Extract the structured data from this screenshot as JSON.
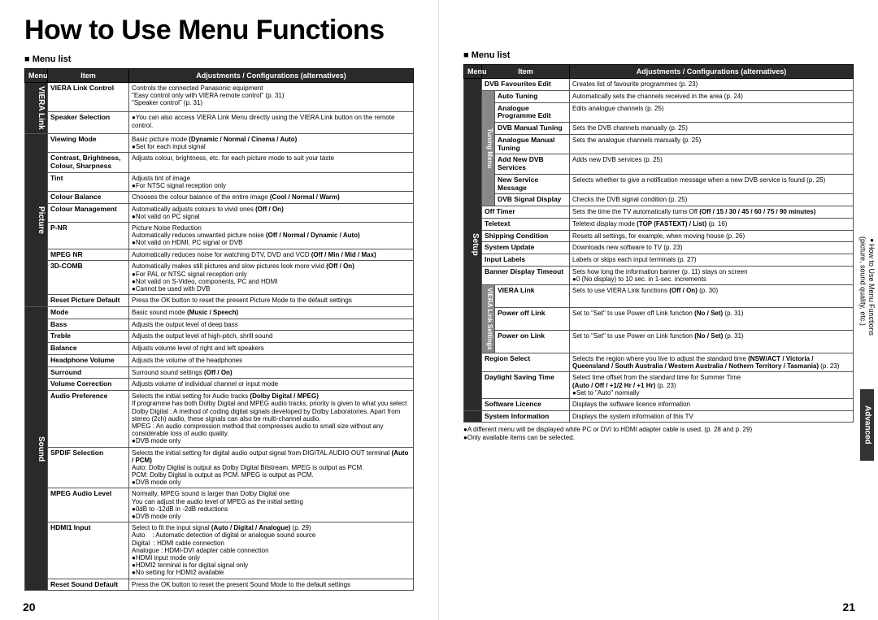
{
  "title": "How to Use Menu Functions",
  "menulist": "Menu list",
  "cols": {
    "menu": "Menu",
    "item": "Item",
    "adj": "Adjustments / Configurations (alternatives)"
  },
  "sec": {
    "viera": "VIERA Link",
    "picture": "Picture",
    "sound": "Sound",
    "setup": "Setup",
    "tuning": "Tuning Menu",
    "vls": "VIERA Link Settings"
  },
  "L": {
    "vieralinkcontrol": {
      "i": "VIERA Link Control",
      "a": "Controls the connected Panasonic equipment<br>\"Easy control only with VIERA remote control\" (p. 31)<br>\"Speaker control\" (p. 31)"
    },
    "speakersel": {
      "i": "Speaker Selection",
      "a": "<span class='dot'>●</span>You can also access VIERA Link Menu directly using the VIERA Link button on the remote control."
    },
    "viewmode": {
      "i": "Viewing Mode",
      "a": "Basic picture mode <b>(Dynamic / Normal / Cinema / Auto)</b><br><span class='dot'>●</span>Set for each input signal"
    },
    "cbsc": {
      "i": "Contrast, Brightness, Colour, Sharpness",
      "a": "Adjusts colour, brightness, etc. for each picture mode to suit your taste"
    },
    "tint": {
      "i": "Tint",
      "a": "Adjusts tint of image<br><span class='dot'>●</span>For NTSC signal reception only"
    },
    "colbal": {
      "i": "Colour Balance",
      "a": "Chooses the colour balance of the entire image <b>(Cool / Normal / Warm)</b>"
    },
    "colmgmt": {
      "i": "Colour Management",
      "a": "Automatically adjusts colours to vivid ones <b>(Off / On)</b><br><span class='dot'>●</span>Not valid on PC signal"
    },
    "pnr": {
      "i": "P-NR",
      "a": "Picture Noise Reduction<br>Automatically reduces unwanted picture noise <b>(Off / Normal / Dynamic / Auto)</b><br><span class='dot'>●</span>Not valid on HDMI, PC signal or DVB"
    },
    "mpegnr": {
      "i": "MPEG NR",
      "a": "Automatically reduces noise for watching DTV, DVD and VCD <b>(Off / Min / Mid / Max)</b>"
    },
    "3dcomb": {
      "i": "3D-COMB",
      "a": "Automatically makes still pictures and slow pictures look more vivid <b>(Off / On)</b><br><span class='dot'>●</span>For PAL or NTSC signal reception only<br><span class='dot'>●</span>Not valid on S-Video, components, PC and HDMI<br><span class='dot'>●</span>Cannot be used with DVB"
    },
    "resetpic": {
      "i": "Reset Picture Default",
      "a": "Press the OK button to reset the present Picture Mode to the default settings"
    },
    "mode": {
      "i": "Mode",
      "a": "Basic sound mode <b>(Music / Speech)</b>"
    },
    "bass": {
      "i": "Bass",
      "a": "Adjusts the output level of deep bass"
    },
    "treble": {
      "i": "Treble",
      "a": "Adjusts the output level of high-pitch, shrill sound"
    },
    "balance": {
      "i": "Balance",
      "a": "Adjusts volume level of right and left speakers"
    },
    "hpvol": {
      "i": "Headphone Volume",
      "a": "Adjusts the volume of the headphones"
    },
    "surround": {
      "i": "Surround",
      "a": "Surround sound settings <b>(Off / On)</b>"
    },
    "volcorr": {
      "i": "Volume Correction",
      "a": "Adjusts volume of individual channel or input mode"
    },
    "audiopref": {
      "i": "Audio Preference",
      "a": "Selects the initial setting for Audio tracks <b>(Dolby Digital / MPEG)</b><br>If programme has both Dolby Digital and MPEG audio tracks, priority is given to what you select<br>Dolby Digital : A method of coding digital signals developed by Dolby Laboratories. Apart from stereo (2ch) audio, these signals can also be multi-channel audio.<br>MPEG : An audio compression method that compresses audio to small size without any considerable loss of audio quality.<br><span class='dot'>●</span>DVB mode only"
    },
    "spdif": {
      "i": "SPDIF Selection",
      "a": "Selects the initial setting for digital audio output signal from DIGITAL AUDIO OUT terminal <b>(Auto / PCM)</b><br>Auto: Dolby Digital is output as Dolby Digital Bitstream. MPEG is output as PCM.<br>PCM: Dolby Digital is output as PCM. MPEG is output as PCM.<br><span class='dot'>●</span>DVB mode only"
    },
    "mpegaudio": {
      "i": "MPEG Audio Level",
      "a": "Normally, MPEG sound is larger than Dolby Digital one<br>You can adjust the audio level of MPEG as the initial setting<br><span class='dot'>●</span>0dB to -12dB in -2dB reductions<br><span class='dot'>●</span>DVB mode only"
    },
    "hdmi1": {
      "i": "HDMI1 Input",
      "a": "Select to fit the input signal <b>(Auto / Digital / Analogue)</b> (p. 29)<br>Auto&nbsp;&nbsp;&nbsp;&nbsp;: Automatic detection of digital or analogue sound source<br>Digital&nbsp;&nbsp;: HDMI cable connection<br>Analogue : HDMI-DVI adapter cable connection<br><span class='dot'>●</span>HDMI input mode only<br><span class='dot'>●</span>HDMI2 terminal is for digital signal only<br><span class='dot'>●</span>No setting for HDMI2 available"
    },
    "resetsnd": {
      "i": "Reset Sound Default",
      "a": "Press the OK button to reset the present Sound Mode to the default settings"
    }
  },
  "R": {
    "dvbfav": {
      "i": "DVB Favourites Edit",
      "a": "Creates list of favourite programmes (p. 23)"
    },
    "autotune": {
      "i": "Auto Tuning",
      "a": "Automatically sets the channels received in the area (p. 24)"
    },
    "anaprog": {
      "i": "Analogue Programme Edit",
      "a": "Edits analogue channels (p. 25)"
    },
    "dvbman": {
      "i": "DVB Manual Tuning",
      "a": "Sets the DVB channels manually (p. 25)"
    },
    "anaman": {
      "i": "Analogue Manual Tuning",
      "a": "Sets the analogue channels manually (p. 25)"
    },
    "addnew": {
      "i": "Add New DVB Services",
      "a": "Adds new DVB services (p. 25)"
    },
    "newsvc": {
      "i": "New Service Message",
      "a": "Selects whether to give a notification message when a new DVB service is found (p. 25)"
    },
    "dvbsig": {
      "i": "DVB Signal Display",
      "a": "Checks the DVB signal condition (p. 25)"
    },
    "offtimer": {
      "i": "Off Timer",
      "a": "Sets the time the TV automatically turns Off <b>(Off / 15 / 30 / 45 / 60 / 75 / 90 minutes)</b>"
    },
    "teletext": {
      "i": "Teletext",
      "a": "Teletext display mode <b>(TOP (FASTEXT) / List)</b> (p. 16)"
    },
    "shipcond": {
      "i": "Shipping Condition",
      "a": "Resets all settings, for example, when moving house (p. 26)"
    },
    "sysupd": {
      "i": "System Update",
      "a": "Downloads new software to TV (p. 23)"
    },
    "inplabels": {
      "i": "Input Labels",
      "a": "Labels or skips each input terminals (p. 27)"
    },
    "banner": {
      "i": "Banner Display Timeout",
      "a": "Sets how long the information banner (p. 11) stays on screen<br><span class='dot'>●</span>0 (No display) to 10 sec. in 1-sec. increments"
    },
    "vieralink": {
      "i": "VIERA Link",
      "a": "Sets to use VIERA Link functions <b>(Off / On)</b> (p. 30)"
    },
    "pwroff": {
      "i": "Power off Link",
      "a": "Set to \"Set\" to use Power off Link function <b>(No / Set)</b> (p. 31)"
    },
    "pwron": {
      "i": "Power on Link",
      "a": "Set to \"Set\" to use Power on Link function <b>(No / Set)</b> (p. 31)"
    },
    "region": {
      "i": "Region Select",
      "a": "Selects the region where you live to adjust the standard time <b>(NSW/ACT / Victoria / Queensland / South Australia / Western Australia / Nothern Territory / Tasmania)</b> (p. 23)"
    },
    "dst": {
      "i": "Daylight Saving Time",
      "a": "Select time offset from the standard time for Summer Time<br><b>(Auto / Off / +1/2 Hr / +1 Hr)</b> (p. 23)<br><span class='dot'>●</span>Set to \"Auto\" normally"
    },
    "swlic": {
      "i": "Software Licence",
      "a": "Displays the software licence information"
    },
    "sysinfo": {
      "i": "System Information",
      "a": "Displays the system information of this TV"
    }
  },
  "notes": {
    "n1": "A different menu will be displayed while PC or DVI to HDMI adapter cable is used. (p. 28 and p. 29)",
    "n2": "Only available items can be selected."
  },
  "pages": {
    "l": "20",
    "r": "21"
  },
  "side": {
    "t1a": "How to Use Menu Functions",
    "t1b": "(picture, sound quality, etc.)",
    "t2": "Advanced"
  }
}
